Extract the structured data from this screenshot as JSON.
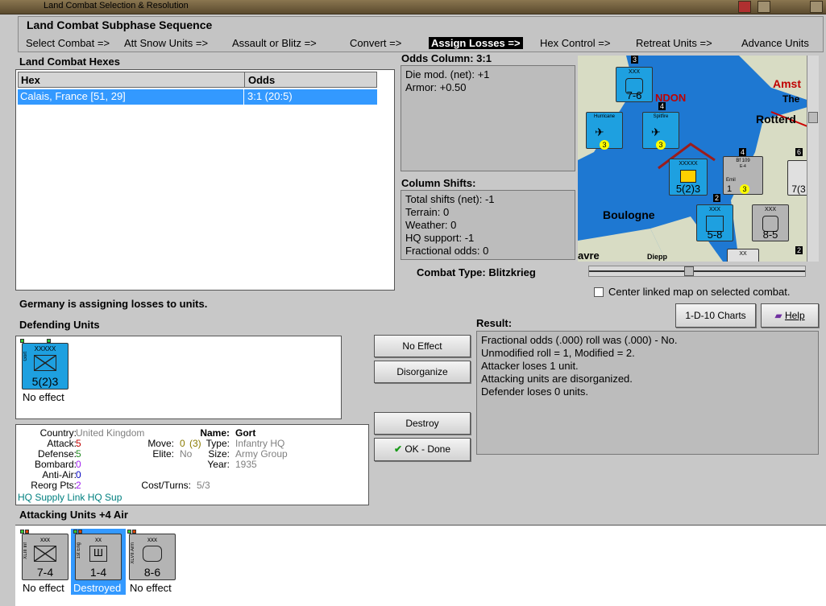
{
  "window": {
    "title": "Land Combat Selection & Resolution"
  },
  "sequence": {
    "title": "Land Combat Subphase Sequence",
    "steps": [
      "Select Combat =>",
      "Att Snow Units =>",
      "Assault or Blitz =>",
      "Convert =>",
      "Assign Losses =>",
      "Hex Control =>",
      "Retreat Units =>",
      "Advance Units"
    ],
    "active": "Assign Losses =>"
  },
  "hexes": {
    "title": "Land Combat Hexes",
    "columns": [
      "Hex",
      "Odds"
    ],
    "rows": [
      {
        "hex": "Calais, France [51, 29]",
        "odds": "3:1 (20:5)"
      }
    ]
  },
  "odds": {
    "title": "Odds Column: 3:1",
    "lines": [
      "Die mod. (net): +1",
      "Armor: +0.50"
    ]
  },
  "shifts": {
    "title": "Column Shifts:",
    "lines": [
      "Total shifts (net): -1",
      "Terrain: 0",
      "Weather: 0",
      "HQ support: -1",
      "Fractional odds: 0"
    ]
  },
  "combat_type": "Combat Type: Blitzkrieg",
  "map": {
    "labels": [
      "NDON",
      "Amst",
      "The",
      "Rotterd",
      "Boulogne",
      "avre",
      "Diepp"
    ],
    "center_checkbox": "Center linked map on selected combat.",
    "counters": {
      "c1": {
        "type": "XXX",
        "val": "7-6"
      },
      "c2": {
        "name": "Hurricane",
        "num": "3"
      },
      "c3": {
        "name": "Spitfire",
        "num": "3"
      },
      "c4": {
        "type": "XXXXX",
        "val": "5(2)3"
      },
      "c5": {
        "name": "Bf 109",
        "sub": "E-4",
        "num": "3",
        "extra": "Emil",
        "lower": "1"
      },
      "c6": {
        "type": "XXX",
        "val": "5-8"
      },
      "c7": {
        "type": "XXX",
        "val": "8-5"
      },
      "c8": {
        "val": "7(3"
      },
      "c9": {
        "type": "XX"
      },
      "nums": [
        "3",
        "4",
        "2",
        "4",
        "6",
        "2"
      ]
    }
  },
  "status_msg": "Germany is assigning losses to units.",
  "defending": {
    "title": "Defending Units",
    "units": [
      {
        "type": "XXXXX",
        "name": "Gort",
        "val": "5(2)3",
        "status": "No effect"
      }
    ]
  },
  "buttons": {
    "no_effect": "No Effect",
    "disorganize": "Disorganize",
    "destroy": "Destroy",
    "ok_done": "OK - Done",
    "charts": "1-D-10 Charts",
    "help": "Help"
  },
  "result": {
    "title": "Result:",
    "lines": [
      "Fractional odds (.000) roll was (.000)  - No.",
      "Unmodified roll = 1, Modified = 2.",
      "Attacker loses 1 unit.",
      "Attacking units are disorganized.",
      "Defender loses 0 units."
    ]
  },
  "details": {
    "country_label": "Country:",
    "country": "United Kingdom",
    "attack_label": "Attack:",
    "attack": "5",
    "defense_label": "Defense:",
    "defense": "5",
    "bombard_label": "Bombard:",
    "bombard": "0",
    "antiair_label": "Anti-Air:",
    "antiair": "0",
    "reorg_label": "Reorg Pts:",
    "reorg": "2",
    "move_label": "Move:",
    "move": "0",
    "move_extra": "(3)",
    "elite_label": "Elite:",
    "elite": "No",
    "cost_label": "Cost/Turns:",
    "cost": "5/3",
    "name_label": "Name:",
    "name": "Gort",
    "type_label": "Type:",
    "type": "Infantry HQ",
    "size_label": "Size:",
    "size": "Army Group",
    "year_label": "Year:",
    "year": "1935",
    "footer": "HQ Supply Link HQ Sup"
  },
  "attacking": {
    "title": "Attacking Units +4 Air",
    "units": [
      {
        "type": "xxx",
        "name": "XLIII Inf",
        "val": "7-4",
        "status": "No effect"
      },
      {
        "type": "xx",
        "name": "1st Eng",
        "val": "1-4",
        "status": "Destroyed"
      },
      {
        "type": "xxx",
        "name": "XLVII Arm",
        "val": "8-6",
        "status": "No effect"
      }
    ]
  },
  "colors": {
    "counter_blue": "#1ea0e0",
    "counter_grey": "#b4b4b4",
    "sea": "#1e78d2",
    "land": "#d8dcc4",
    "selected": "#3399ff"
  }
}
